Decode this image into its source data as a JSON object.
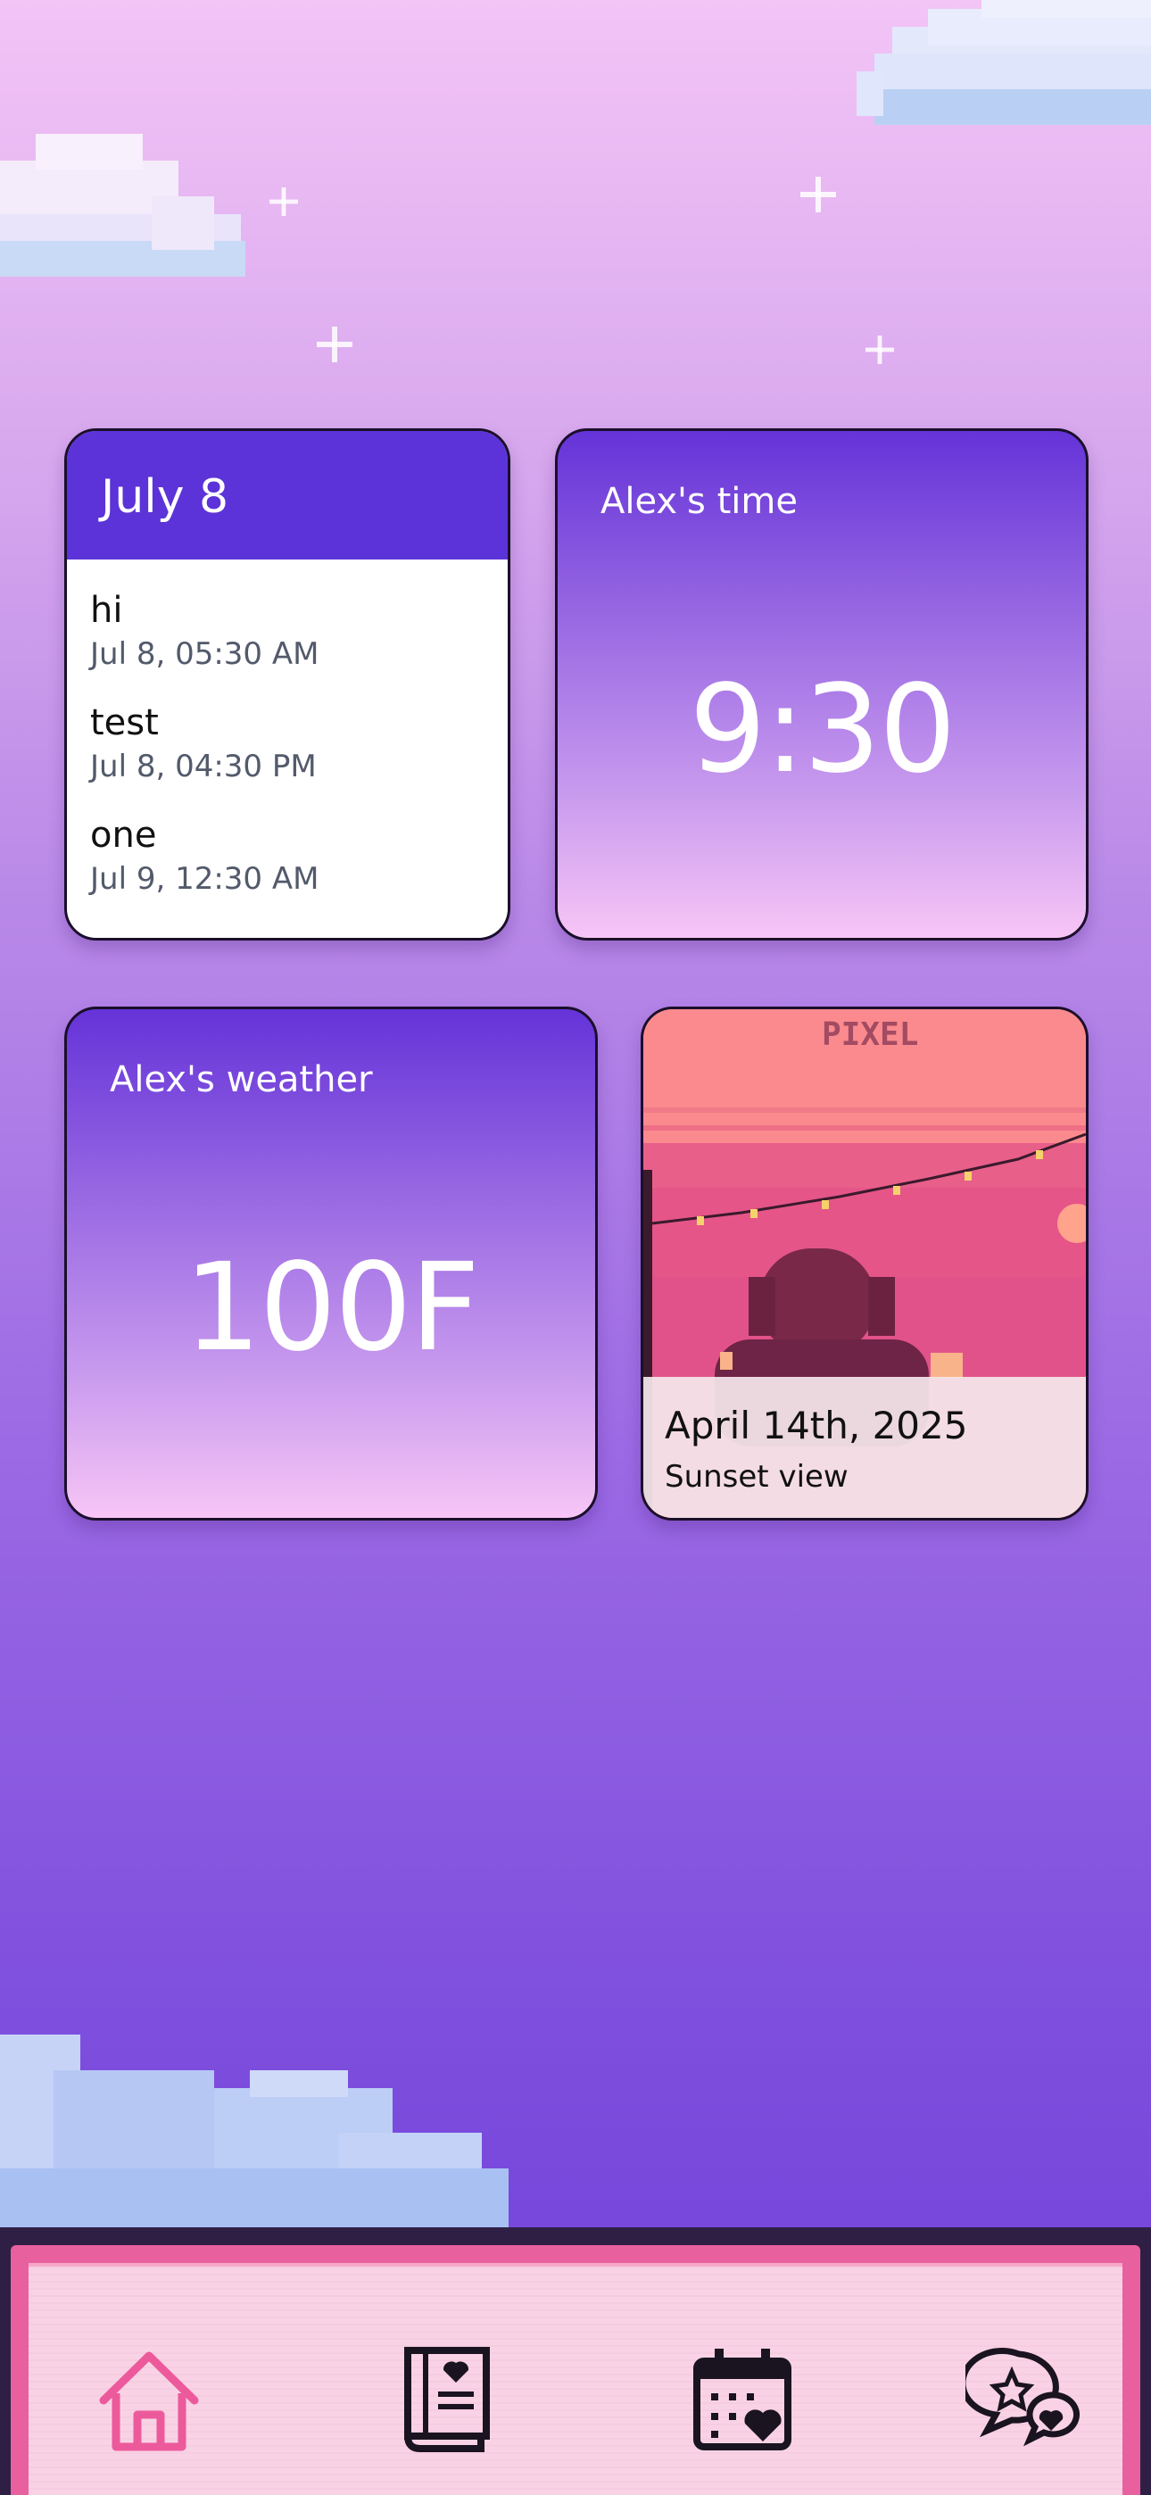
{
  "calendar_widget": {
    "header": "July 8",
    "events": [
      {
        "title": "hi",
        "time": "Jul 8, 05:30 AM"
      },
      {
        "title": "test",
        "time": "Jul 8, 04:30 PM"
      },
      {
        "title": "one",
        "time": "Jul 9, 12:30 AM"
      }
    ]
  },
  "time_widget": {
    "label": "Alex's time",
    "value": "9:30"
  },
  "weather_widget": {
    "label": "Alex's weather",
    "value": "100F"
  },
  "photo_widget": {
    "watermark": "PIXEL",
    "date": "April 14th, 2025",
    "caption": "Sunset view"
  },
  "nav": {
    "items": [
      {
        "icon": "home-icon",
        "active": true
      },
      {
        "icon": "journal-heart-icon",
        "active": false
      },
      {
        "icon": "calendar-heart-icon",
        "active": false
      },
      {
        "icon": "chat-heart-icon",
        "active": false
      }
    ],
    "active_color": "#ec5a9c",
    "icon_color": "#1a1420"
  },
  "colors": {
    "accent": "#5b33d8",
    "nav_bg": "#f9d3e5",
    "nav_border": "#e9609f"
  }
}
